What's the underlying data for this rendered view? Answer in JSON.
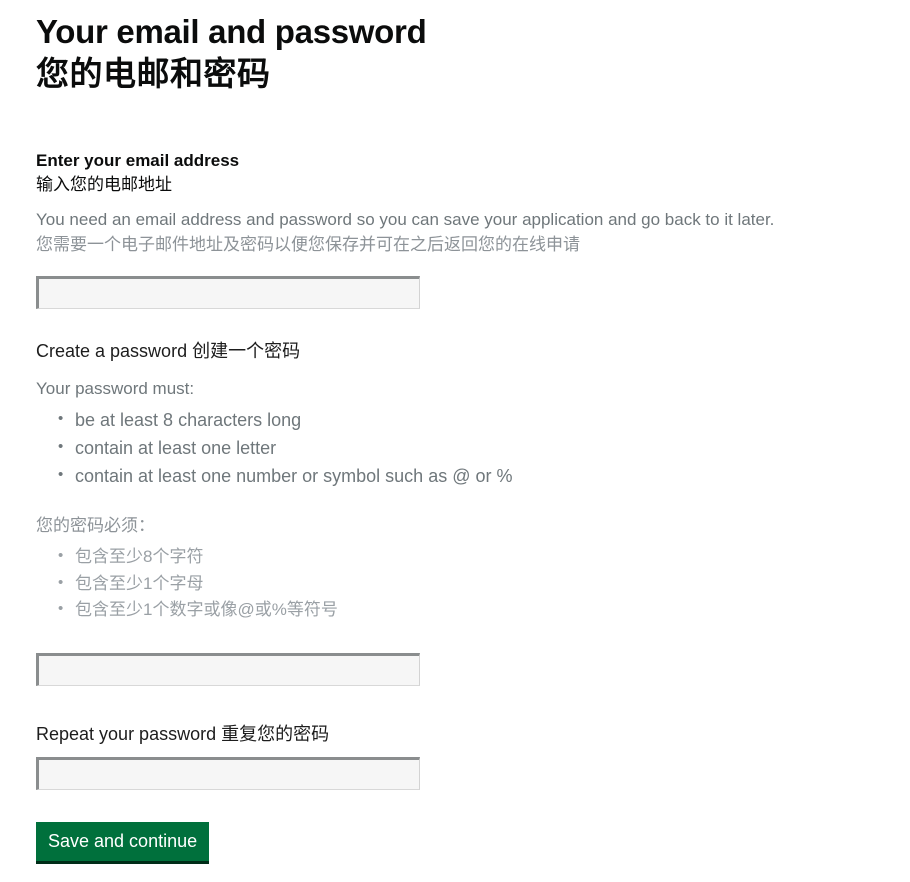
{
  "heading": {
    "title_en": "Your email and password",
    "title_cn": "您的电邮和密码"
  },
  "email_field": {
    "label_en": "Enter your email address",
    "label_cn": "输入您的电邮地址",
    "hint_en": "You need an email address and password so you can save your application and go back to it later.",
    "hint_cn": "您需要一个电子邮件地址及密码以便您保存并可在之后返回您的在线申请",
    "value": "",
    "placeholder": ""
  },
  "password_field": {
    "label": "Create a password 创建一个密码",
    "must_en": "Your password must:",
    "requirements_en": [
      "be at least 8 characters long",
      "contain at least one letter",
      "contain at least one number or symbol such as @ or %"
    ],
    "must_cn": "您的密码必须：",
    "requirements_cn": [
      "包含至少8个字符",
      "包含至少1个字母",
      "包含至少1个数字或像@或%等符号"
    ],
    "value": "",
    "placeholder": ""
  },
  "repeat_password_field": {
    "label": "Repeat your password 重复您的密码",
    "value": "",
    "placeholder": ""
  },
  "actions": {
    "submit_label": "Save and continue"
  },
  "colors": {
    "text_primary": "#0b0c0c",
    "text_secondary": "#6f777b",
    "text_secondary_cn": "#9aa0a5",
    "button_green": "#00703c",
    "button_shadow": "#002d18",
    "input_fill": "#f6f6f6",
    "input_border": "#8a8d8e"
  }
}
